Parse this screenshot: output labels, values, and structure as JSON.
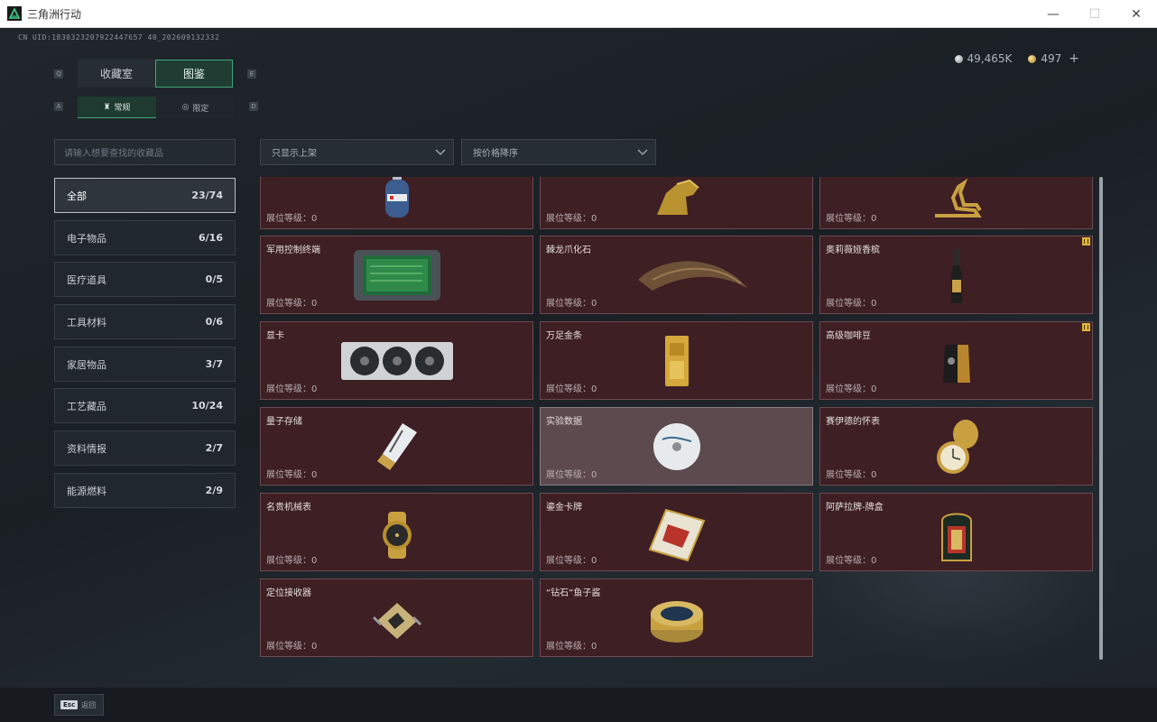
{
  "window": {
    "title": "三角洲行动",
    "minimize": "—",
    "maximize": "☐",
    "close": "✕"
  },
  "uid": "CN UID:1830323207922447657 40_202609132332",
  "currency": {
    "silver": "49,465K",
    "gold": "497",
    "plus": "+"
  },
  "tabs": {
    "q_key": "Q",
    "e_key": "E",
    "items": [
      {
        "label": "收藏室"
      },
      {
        "label": "图鉴"
      }
    ]
  },
  "subtabs": {
    "a_key": "A",
    "d_key": "D",
    "items": [
      {
        "label": "常规"
      },
      {
        "label": "限定"
      }
    ]
  },
  "search": {
    "placeholder": "请输入想要查找的收藏品"
  },
  "filters": {
    "shelf": "只显示上架",
    "sort": "按价格降序"
  },
  "categories": [
    {
      "label": "全部",
      "count": "23/74"
    },
    {
      "label": "电子物品",
      "count": "6/16"
    },
    {
      "label": "医疗道具",
      "count": "0/5"
    },
    {
      "label": "工具材料",
      "count": "0/6"
    },
    {
      "label": "家居物品",
      "count": "3/7"
    },
    {
      "label": "工艺藏品",
      "count": "10/24"
    },
    {
      "label": "资料情报",
      "count": "2/7"
    },
    {
      "label": "能源燃料",
      "count": "2/9"
    }
  ],
  "items": [
    {
      "name": "",
      "level": "展位等级：0"
    },
    {
      "name": "",
      "level": "展位等级：0"
    },
    {
      "name": "",
      "level": "展位等级：0"
    },
    {
      "name": "军用控制终端",
      "level": "展位等级：0"
    },
    {
      "name": "棘龙爪化石",
      "level": "展位等级：0"
    },
    {
      "name": "奥莉薇娅香槟",
      "level": "展位等级：0"
    },
    {
      "name": "显卡",
      "level": "展位等级：0"
    },
    {
      "name": "万足金条",
      "level": "展位等级：0"
    },
    {
      "name": "高级咖啡豆",
      "level": "展位等级：0"
    },
    {
      "name": "量子存储",
      "level": "展位等级：0"
    },
    {
      "name": "实验数据",
      "level": "展位等级：0"
    },
    {
      "name": "赛伊德的怀表",
      "level": "展位等级：0"
    },
    {
      "name": "名贵机械表",
      "level": "展位等级：0"
    },
    {
      "name": "鎏金卡牌",
      "level": "展位等级：0"
    },
    {
      "name": "阿萨拉牌-牌盒",
      "level": "展位等级：0"
    },
    {
      "name": "定位接收器",
      "level": "展位等级：0"
    },
    {
      "name": "“钻石”鱼子酱",
      "level": "展位等级：0"
    }
  ],
  "bottom": {
    "esc_key": "Esc",
    "back_label": "返回"
  }
}
